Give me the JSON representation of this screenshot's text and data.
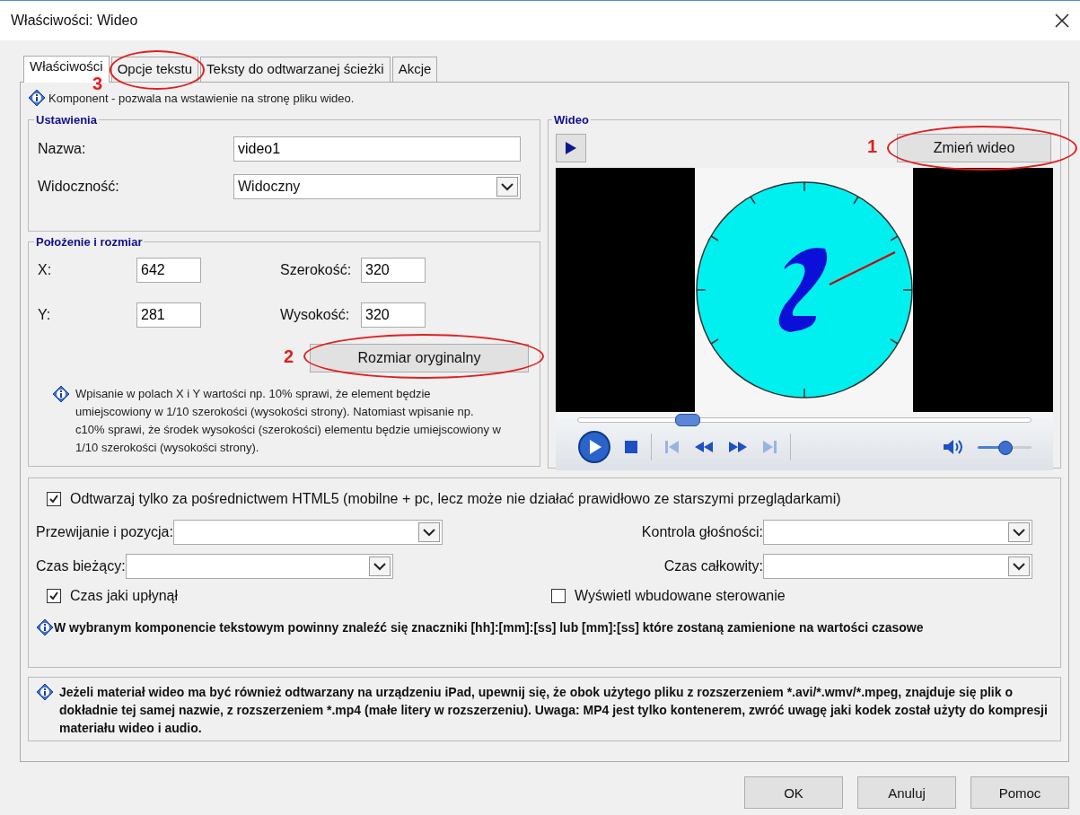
{
  "window": {
    "title": "Właściwości: Wideo"
  },
  "tabs": [
    {
      "label": "Właściwości",
      "selected": true
    },
    {
      "label": "Opcje tekstu",
      "selected": false
    },
    {
      "label": "Teksty do odtwarzanej ścieżki",
      "selected": false
    },
    {
      "label": "Akcje",
      "selected": false
    }
  ],
  "description": "Komponent - pozwala na wstawienie na stronę pliku wideo.",
  "settings": {
    "title": "Ustawienia",
    "name_label": "Nazwa:",
    "name_value": "video1",
    "visibility_label": "Widoczność:",
    "visibility_value": "Widoczny"
  },
  "position": {
    "title": "Położenie i rozmiar",
    "fields": [
      {
        "label": "X:",
        "value": "642"
      },
      {
        "label": "Szerokość:",
        "value": "320"
      },
      {
        "label": "Y:",
        "value": "281"
      },
      {
        "label": "Wysokość:",
        "value": "320"
      }
    ],
    "button": "Rozmiar oryginalny",
    "note": "Wpisanie w polach X i Y wartości np. 10% sprawi, że element będzie umiejscowiony w 1/10 szerokości (wysokości strony). Natomiast wpisanie np. c10% sprawi, że środek wysokości (szerokości) elementu będzie umiejscowiony w 1/10 szerokości (wysokości strony)."
  },
  "video": {
    "title": "Wideo",
    "change_button": "Zmień wideo",
    "seek": {
      "level": 0.24
    },
    "volume": {
      "level": 0.52
    }
  },
  "html5": {
    "label": "Odtwarzaj tylko za pośrednictwem HTML5 (mobilne + pc, lecz może nie działać prawidłowo ze starszymi przeglądarkami)",
    "checked": true
  },
  "dropdowns": [
    {
      "label": "Przewijanie i pozycja:"
    },
    {
      "label": "Kontrola głośności:"
    },
    {
      "label": "Czas bieżący:"
    },
    {
      "label": "Czas całkowity:"
    }
  ],
  "checkboxes": [
    {
      "label": "Czas jaki upłynął",
      "checked": true
    },
    {
      "label": "Wyświetl wbudowane sterowanie",
      "checked": false
    }
  ],
  "time_note": "W wybranym komponencie tekstowym powinny znaleźć się znaczniki [hh]:[mm]:[ss] lub [mm]:[ss] które zostaną zamienione na wartości czasowe",
  "ipad_note": "Jeżeli materiał wideo ma być również odtwarzany na urządzeniu iPad, upewnij się, że obok użytego pliku z rozszerzeniem *.avi/*.wmv/*.mpeg, znajduje się plik o dokładnie tej samej nazwie, z rozszerzeniem *.mp4 (małe litery w rozszerzeniu). Uwaga: MP4 jest tylko kontenerem, zwróć uwagę jaki kodek został użyty do kompresji materiału wideo i audio.",
  "buttons": [
    "OK",
    "Anuluj",
    "Pomoc"
  ],
  "annotations": [
    {
      "label": "1"
    },
    {
      "label": "2"
    },
    {
      "label": "3"
    }
  ]
}
